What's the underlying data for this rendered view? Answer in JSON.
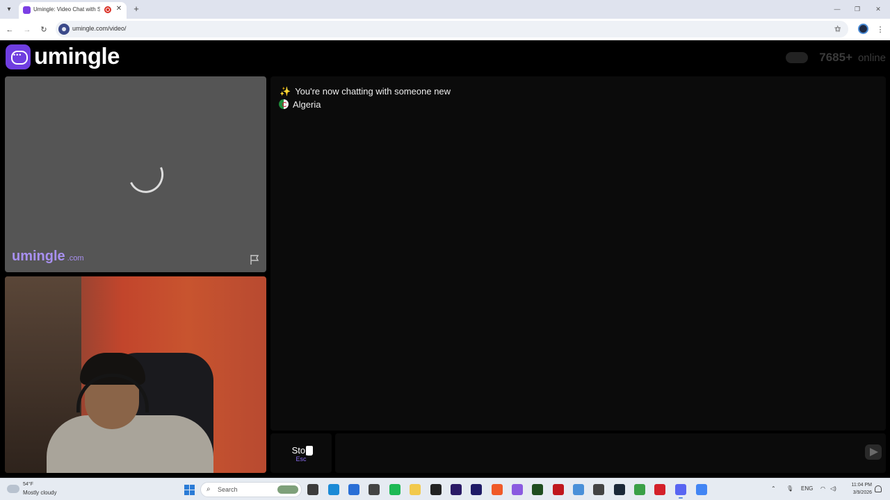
{
  "browser": {
    "tab_title": "Umingle: Video Chat with St",
    "url": "umingle.com/video/"
  },
  "site": {
    "logo_text": "umingle",
    "online_count": "7685+",
    "online_label": "online"
  },
  "video": {
    "watermark": "umingle",
    "watermark_suffix": ".com"
  },
  "chat": {
    "system_message": "You're now chatting with someone new",
    "country": "Algeria"
  },
  "controls": {
    "stop_label": "Stop",
    "stop_shortcut": "Esc"
  },
  "taskbar": {
    "weather_temp": "54°F",
    "weather_condition": "Mostly cloudy",
    "search_label": "Search",
    "language": "ENG",
    "time": "11:04 PM",
    "date": "3/9/2026",
    "apps": [
      {
        "name": "file-explorer-icon",
        "color": "#3c3c3c"
      },
      {
        "name": "edge-icon",
        "color": "#1b8ad6"
      },
      {
        "name": "store-icon",
        "color": "#2a6fd6"
      },
      {
        "name": "pen-app-icon",
        "color": "#444444"
      },
      {
        "name": "spotify-icon",
        "color": "#1db954"
      },
      {
        "name": "folder-icon",
        "color": "#f2c94c"
      },
      {
        "name": "capcut-icon",
        "color": "#222222"
      },
      {
        "name": "premiere-icon",
        "color": "#2b1a66"
      },
      {
        "name": "after-effects-icon",
        "color": "#1f1a66"
      },
      {
        "name": "brave-icon",
        "color": "#f05a28"
      },
      {
        "name": "copilot-icon",
        "color": "#8a5ae0"
      },
      {
        "name": "game-app-icon",
        "color": "#1f4d1f"
      },
      {
        "name": "record-app-icon",
        "color": "#c0171d"
      },
      {
        "name": "notepad-icon",
        "color": "#4a90d9"
      },
      {
        "name": "settings-app-icon",
        "color": "#444444"
      },
      {
        "name": "steam-icon",
        "color": "#1b2838"
      },
      {
        "name": "xbox-icon",
        "color": "#3aa047"
      },
      {
        "name": "acrobat-icon",
        "color": "#d4202a"
      },
      {
        "name": "discord-icon",
        "color": "#5865f2"
      },
      {
        "name": "chrome-icon",
        "color": "#4285f4"
      }
    ]
  }
}
